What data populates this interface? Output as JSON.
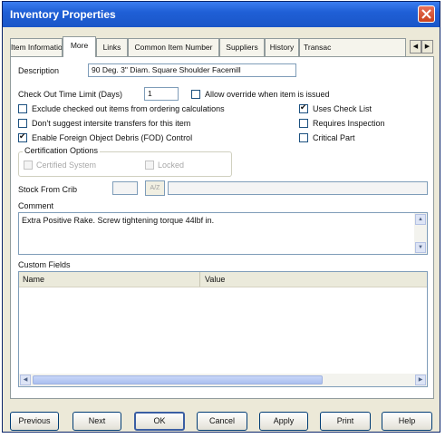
{
  "window": {
    "title": "Inventory Properties"
  },
  "tabs": [
    {
      "label": "Item Information"
    },
    {
      "label": "More",
      "active": true
    },
    {
      "label": "Links"
    },
    {
      "label": "Common Item Number"
    },
    {
      "label": "Suppliers"
    },
    {
      "label": "History"
    },
    {
      "label": "Transac"
    }
  ],
  "form": {
    "description_label": "Description",
    "description_value": "90 Deg. 3\" Diam. Square Shoulder Facemill",
    "checkout_label": "Check Out Time Limit (Days)",
    "checkout_value": "1",
    "allow_override_label": "Allow override when item is issued",
    "exclude_label": "Exclude checked out items from ordering calculations",
    "uses_checklist_label": "Uses Check List",
    "dont_suggest_label": "Don't suggest intersite transfers for this item",
    "requires_inspection_label": "Requires Inspection",
    "fod_label": "Enable Foreign Object Debris (FOD) Control",
    "critical_part_label": "Critical Part",
    "cert_group_label": "Certification Options",
    "certified_system_label": "Certified System",
    "locked_label": "Locked",
    "stock_crib_label": "Stock From Crib",
    "stock_crib_value": "",
    "stock_crib_desc": "",
    "browse_label": "A/Z",
    "comment_label": "Comment",
    "comment_value": "Extra Positive Rake.  Screw tightening torque 44lbf in.",
    "custom_fields_label": "Custom Fields",
    "custom_cols": [
      "Name",
      "Value"
    ]
  },
  "checkbox_states": {
    "allow_override": false,
    "exclude": false,
    "uses_checklist": true,
    "dont_suggest": false,
    "requires_inspection": false,
    "fod": true,
    "critical_part": false,
    "certified_system": false,
    "locked": false
  },
  "buttons": {
    "previous": "Previous",
    "next": "Next",
    "ok": "OK",
    "cancel": "Cancel",
    "apply": "Apply",
    "print": "Print",
    "help": "Help"
  }
}
